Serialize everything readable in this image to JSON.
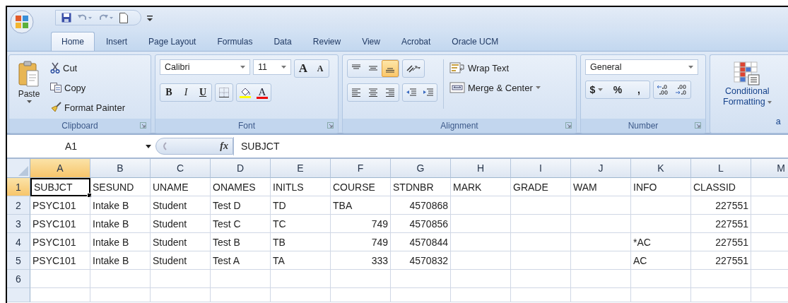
{
  "tabs": [
    {
      "label": "Home",
      "selected": true
    },
    {
      "label": "Insert",
      "selected": false
    },
    {
      "label": "Page Layout",
      "selected": false
    },
    {
      "label": "Formulas",
      "selected": false
    },
    {
      "label": "Data",
      "selected": false
    },
    {
      "label": "Review",
      "selected": false
    },
    {
      "label": "View",
      "selected": false
    },
    {
      "label": "Acrobat",
      "selected": false
    },
    {
      "label": "Oracle UCM",
      "selected": false
    }
  ],
  "clipboard": {
    "label": "Clipboard",
    "paste": "Paste",
    "cut": "Cut",
    "copy": "Copy",
    "format_painter": "Format Painter"
  },
  "font": {
    "label": "Font",
    "font_name": "Calibri",
    "font_size": "11",
    "grow_font": "A",
    "shrink_font": "A",
    "bold": "B",
    "italic": "I",
    "underline": "U",
    "font_color": "A"
  },
  "alignment": {
    "label": "Alignment",
    "vertical": [
      {
        "selected": false
      },
      {
        "selected": false
      },
      {
        "selected": true
      }
    ],
    "wrap_text": "Wrap Text",
    "merge_center": "Merge & Center"
  },
  "number": {
    "label": "Number",
    "format": "General",
    "currency": "$",
    "percent": "%",
    "comma": ","
  },
  "styles": {
    "conditional_formatting": [
      "Conditional",
      "Formatting"
    ],
    "next_button": "a"
  },
  "formula_bar": {
    "name_box": "A1",
    "function_label": "fx",
    "value": "SUBJCT"
  },
  "sheet": {
    "columns": [
      {
        "label": "A",
        "selected": true
      },
      {
        "label": "B",
        "selected": false
      },
      {
        "label": "C",
        "selected": false
      },
      {
        "label": "D",
        "selected": false
      },
      {
        "label": "E",
        "selected": false
      },
      {
        "label": "F",
        "selected": false
      },
      {
        "label": "G",
        "selected": false
      },
      {
        "label": "H",
        "selected": false
      },
      {
        "label": "I",
        "selected": false
      },
      {
        "label": "J",
        "selected": false
      },
      {
        "label": "K",
        "selected": false
      },
      {
        "label": "L",
        "selected": false
      },
      {
        "label": "M",
        "selected": false
      }
    ],
    "rows": [
      {
        "label": "1",
        "selected": true,
        "cells": [
          "SUBJCT",
          "SESUND",
          "UNAME",
          "ONAMES",
          "INITLS",
          "COURSE",
          "STDNBR",
          "MARK",
          "GRADE",
          "WAM",
          "INFO",
          "CLASSID"
        ]
      },
      {
        "label": "2",
        "selected": false,
        "cells": [
          "PSYC101",
          "Intake B",
          "Student",
          "Test D",
          "TD",
          "TBA",
          "4570868",
          null,
          null,
          null,
          null,
          "227551"
        ]
      },
      {
        "label": "3",
        "selected": false,
        "cells": [
          "PSYC101",
          "Intake B",
          "Student",
          "Test C",
          "TC",
          "749",
          "4570856",
          null,
          null,
          null,
          null,
          "227551"
        ]
      },
      {
        "label": "4",
        "selected": false,
        "cells": [
          "PSYC101",
          "Intake B",
          "Student",
          "Test B",
          "TB",
          "749",
          "4570844",
          null,
          null,
          null,
          "*AC",
          "227551"
        ]
      },
      {
        "label": "5",
        "selected": false,
        "cells": [
          "PSYC101",
          "Intake B",
          "Student",
          "Test A",
          "TA",
          "333",
          "4570832",
          null,
          null,
          null,
          "AC",
          "227551"
        ]
      },
      {
        "label": "6",
        "selected": false,
        "cells": []
      }
    ]
  }
}
